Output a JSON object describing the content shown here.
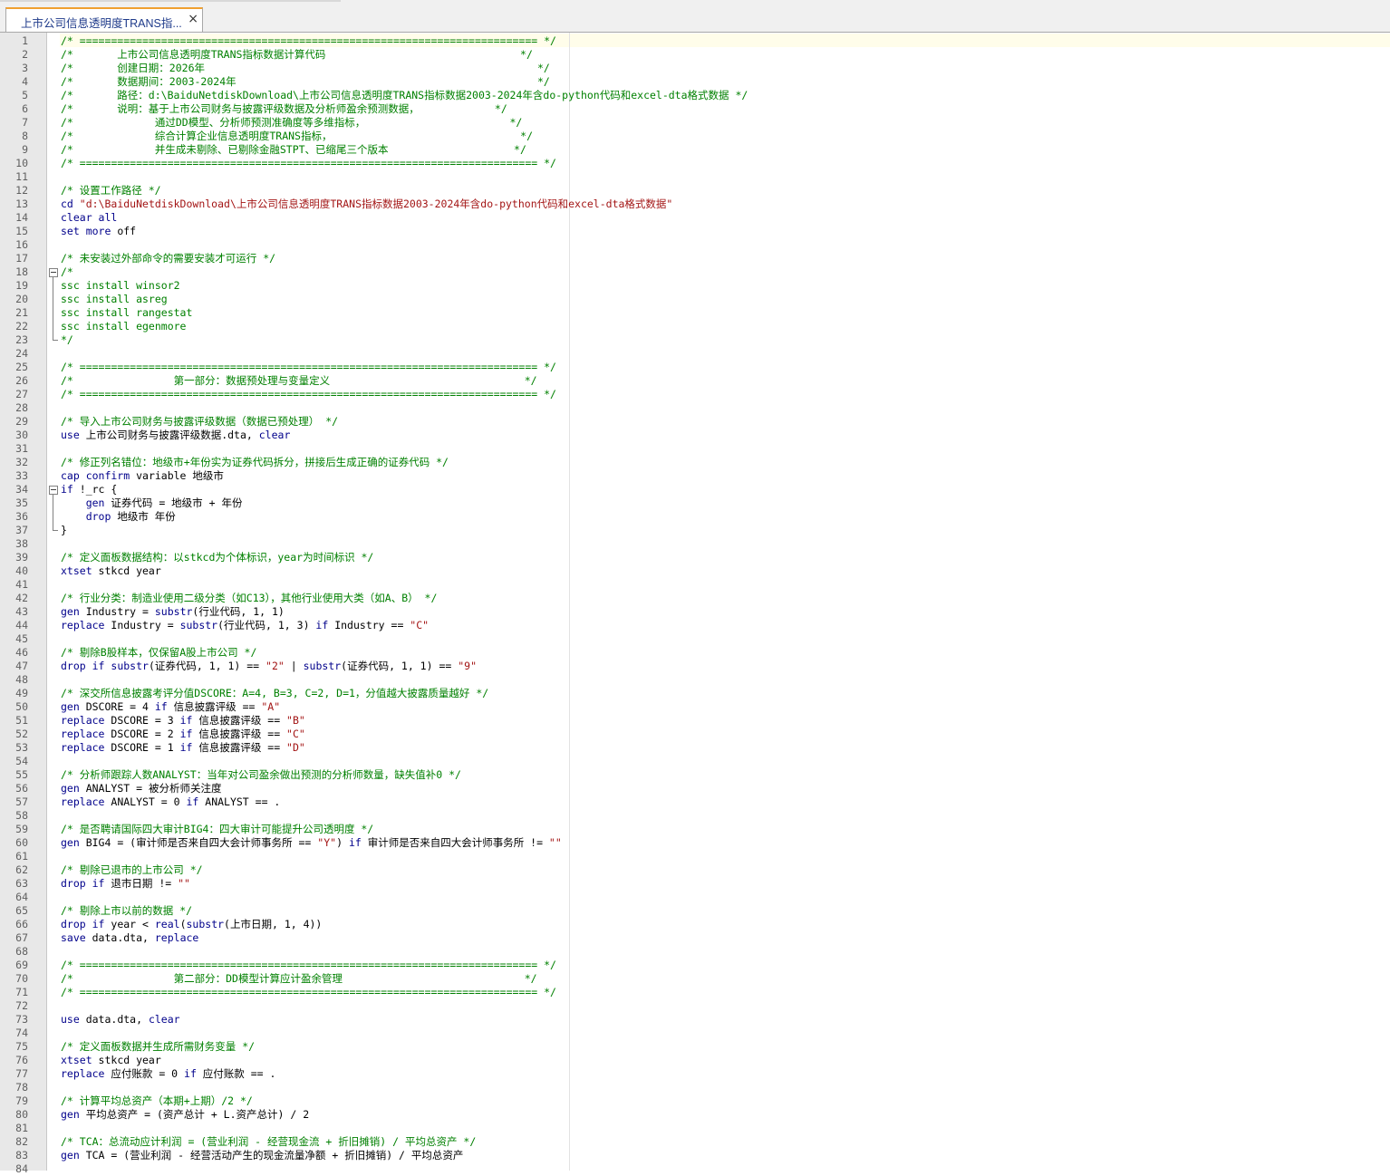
{
  "tab": {
    "title": "上市公司信息透明度TRANS指...",
    "close": "×"
  },
  "lines": [
    [
      [
        "c",
        "/* ========================================================================= */"
      ]
    ],
    [
      [
        "c",
        "/*       上市公司信息透明度TRANS指标数据计算代码                               */"
      ]
    ],
    [
      [
        "c",
        "/*       创建日期：2026年                                                     */"
      ]
    ],
    [
      [
        "c",
        "/*       数据期间：2003-2024年                                                */"
      ]
    ],
    [
      [
        "c",
        "/*       路径：d:\\BaiduNetdiskDownload\\上市公司信息透明度TRANS指标数据2003-2024年含do-python代码和excel-dta格式数据 */"
      ]
    ],
    [
      [
        "c",
        "/*       说明：基于上市公司财务与披露评级数据及分析师盈余预测数据，            */"
      ]
    ],
    [
      [
        "c",
        "/*             通过DD模型、分析师预测准确度等多维指标，                       */"
      ]
    ],
    [
      [
        "c",
        "/*             综合计算企业信息透明度TRANS指标，                              */"
      ]
    ],
    [
      [
        "c",
        "/*             并生成未剔除、已剔除金融STPT、已缩尾三个版本                    */"
      ]
    ],
    [
      [
        "c",
        "/* ========================================================================= */"
      ]
    ],
    [],
    [
      [
        "c",
        "/* 设置工作路径 */"
      ]
    ],
    [
      [
        "k",
        "cd "
      ],
      [
        "s",
        "\"d:\\BaiduNetdiskDownload\\上市公司信息透明度TRANS指标数据2003-2024年含do-python代码和excel-dta格式数据\""
      ]
    ],
    [
      [
        "k",
        "clear all"
      ]
    ],
    [
      [
        "k",
        "set more "
      ],
      [
        "t",
        "off"
      ]
    ],
    [],
    [
      [
        "c",
        "/* 未安装过外部命令的需要安装才可运行 */"
      ]
    ],
    [
      [
        "c",
        "/*"
      ]
    ],
    [
      [
        "c",
        "ssc install winsor2"
      ]
    ],
    [
      [
        "c",
        "ssc install asreg"
      ]
    ],
    [
      [
        "c",
        "ssc install rangestat"
      ]
    ],
    [
      [
        "c",
        "ssc install egenmore"
      ]
    ],
    [
      [
        "c",
        "*/"
      ]
    ],
    [],
    [
      [
        "c",
        "/* ========================================================================= */"
      ]
    ],
    [
      [
        "c",
        "/*                第一部分：数据预处理与变量定义                               */"
      ]
    ],
    [
      [
        "c",
        "/* ========================================================================= */"
      ]
    ],
    [],
    [
      [
        "c",
        "/* 导入上市公司财务与披露评级数据（数据已预处理） */"
      ]
    ],
    [
      [
        "k",
        "use "
      ],
      [
        "t",
        "上市公司财务与披露评级数据.dta, "
      ],
      [
        "k",
        "clear"
      ]
    ],
    [],
    [
      [
        "c",
        "/* 修正列名错位：地级市+年份实为证券代码拆分，拼接后生成正确的证券代码 */"
      ]
    ],
    [
      [
        "k",
        "cap confirm "
      ],
      [
        "t",
        "variable 地级市"
      ]
    ],
    [
      [
        "k",
        "if "
      ],
      [
        "t",
        "!_rc {"
      ]
    ],
    [
      [
        "t",
        "    "
      ],
      [
        "k",
        "gen "
      ],
      [
        "t",
        "证券代码 = 地级市 + 年份"
      ]
    ],
    [
      [
        "t",
        "    "
      ],
      [
        "k",
        "drop "
      ],
      [
        "t",
        "地级市 年份"
      ]
    ],
    [
      [
        "t",
        "}"
      ]
    ],
    [],
    [
      [
        "c",
        "/* 定义面板数据结构：以stkcd为个体标识，year为时间标识 */"
      ]
    ],
    [
      [
        "k",
        "xtset "
      ],
      [
        "t",
        "stkcd year"
      ]
    ],
    [],
    [
      [
        "c",
        "/* 行业分类：制造业使用二级分类（如C13），其他行业使用大类（如A、B） */"
      ]
    ],
    [
      [
        "k",
        "gen "
      ],
      [
        "t",
        "Industry = "
      ],
      [
        "k",
        "substr"
      ],
      [
        "t",
        "(行业代码, 1, 1)"
      ]
    ],
    [
      [
        "k",
        "replace "
      ],
      [
        "t",
        "Industry = "
      ],
      [
        "k",
        "substr"
      ],
      [
        "t",
        "(行业代码, 1, 3) "
      ],
      [
        "k",
        "if "
      ],
      [
        "t",
        "Industry == "
      ],
      [
        "s",
        "\"C\""
      ]
    ],
    [],
    [
      [
        "c",
        "/* 剔除B股样本，仅保留A股上市公司 */"
      ]
    ],
    [
      [
        "k",
        "drop if "
      ],
      [
        "k",
        "substr"
      ],
      [
        "t",
        "(证券代码, 1, 1) == "
      ],
      [
        "s",
        "\"2\""
      ],
      [
        "t",
        " | "
      ],
      [
        "k",
        "substr"
      ],
      [
        "t",
        "(证券代码, 1, 1) == "
      ],
      [
        "s",
        "\"9\""
      ]
    ],
    [],
    [
      [
        "c",
        "/* 深交所信息披露考评分值DSCORE：A=4, B=3, C=2, D=1，分值越大披露质量越好 */"
      ]
    ],
    [
      [
        "k",
        "gen "
      ],
      [
        "t",
        "DSCORE = 4 "
      ],
      [
        "k",
        "if "
      ],
      [
        "t",
        "信息披露评级 == "
      ],
      [
        "s",
        "\"A\""
      ]
    ],
    [
      [
        "k",
        "replace "
      ],
      [
        "t",
        "DSCORE = 3 "
      ],
      [
        "k",
        "if "
      ],
      [
        "t",
        "信息披露评级 == "
      ],
      [
        "s",
        "\"B\""
      ]
    ],
    [
      [
        "k",
        "replace "
      ],
      [
        "t",
        "DSCORE = 2 "
      ],
      [
        "k",
        "if "
      ],
      [
        "t",
        "信息披露评级 == "
      ],
      [
        "s",
        "\"C\""
      ]
    ],
    [
      [
        "k",
        "replace "
      ],
      [
        "t",
        "DSCORE = 1 "
      ],
      [
        "k",
        "if "
      ],
      [
        "t",
        "信息披露评级 == "
      ],
      [
        "s",
        "\"D\""
      ]
    ],
    [],
    [
      [
        "c",
        "/* 分析师跟踪人数ANALYST：当年对公司盈余做出预测的分析师数量，缺失值补0 */"
      ]
    ],
    [
      [
        "k",
        "gen "
      ],
      [
        "t",
        "ANALYST = 被分析师关注度"
      ]
    ],
    [
      [
        "k",
        "replace "
      ],
      [
        "t",
        "ANALYST = 0 "
      ],
      [
        "k",
        "if "
      ],
      [
        "t",
        "ANALYST == ."
      ]
    ],
    [],
    [
      [
        "c",
        "/* 是否聘请国际四大审计BIG4：四大审计可能提升公司透明度 */"
      ]
    ],
    [
      [
        "k",
        "gen "
      ],
      [
        "t",
        "BIG4 = (审计师是否来自四大会计师事务所 == "
      ],
      [
        "s",
        "\"Y\""
      ],
      [
        "t",
        ") "
      ],
      [
        "k",
        "if "
      ],
      [
        "t",
        "审计师是否来自四大会计师事务所 != "
      ],
      [
        "s",
        "\"\""
      ]
    ],
    [],
    [
      [
        "c",
        "/* 剔除已退市的上市公司 */"
      ]
    ],
    [
      [
        "k",
        "drop if "
      ],
      [
        "t",
        "退市日期 != "
      ],
      [
        "s",
        "\"\""
      ]
    ],
    [],
    [
      [
        "c",
        "/* 剔除上市以前的数据 */"
      ]
    ],
    [
      [
        "k",
        "drop if "
      ],
      [
        "t",
        "year < "
      ],
      [
        "k",
        "real"
      ],
      [
        "t",
        "("
      ],
      [
        "k",
        "substr"
      ],
      [
        "t",
        "(上市日期, 1, 4))"
      ]
    ],
    [
      [
        "k",
        "save "
      ],
      [
        "t",
        "data.dta, "
      ],
      [
        "k",
        "replace"
      ]
    ],
    [],
    [
      [
        "c",
        "/* ========================================================================= */"
      ]
    ],
    [
      [
        "c",
        "/*                第二部分：DD模型计算应计盈余管理                             */"
      ]
    ],
    [
      [
        "c",
        "/* ========================================================================= */"
      ]
    ],
    [],
    [
      [
        "k",
        "use "
      ],
      [
        "t",
        "data.dta, "
      ],
      [
        "k",
        "clear"
      ]
    ],
    [],
    [
      [
        "c",
        "/* 定义面板数据并生成所需财务变量 */"
      ]
    ],
    [
      [
        "k",
        "xtset "
      ],
      [
        "t",
        "stkcd year"
      ]
    ],
    [
      [
        "k",
        "replace "
      ],
      [
        "t",
        "应付账款 = 0 "
      ],
      [
        "k",
        "if "
      ],
      [
        "t",
        "应付账款 == ."
      ]
    ],
    [],
    [
      [
        "c",
        "/* 计算平均总资产（本期+上期）/2 */"
      ]
    ],
    [
      [
        "k",
        "gen "
      ],
      [
        "t",
        "平均总资产 = (资产总计 + L.资产总计) / 2"
      ]
    ],
    [],
    [
      [
        "c",
        "/* TCA：总流动应计利润 = (营业利润 - 经营现金流 + 折旧摊销) / 平均总资产 */"
      ]
    ],
    [
      [
        "k",
        "gen "
      ],
      [
        "t",
        "TCA = (营业利润 - 经营活动产生的现金流量净额 + 折旧摊销) / 平均总资产"
      ]
    ],
    []
  ],
  "fold_blocks": [
    [
      18,
      23
    ],
    [
      34,
      37
    ]
  ]
}
